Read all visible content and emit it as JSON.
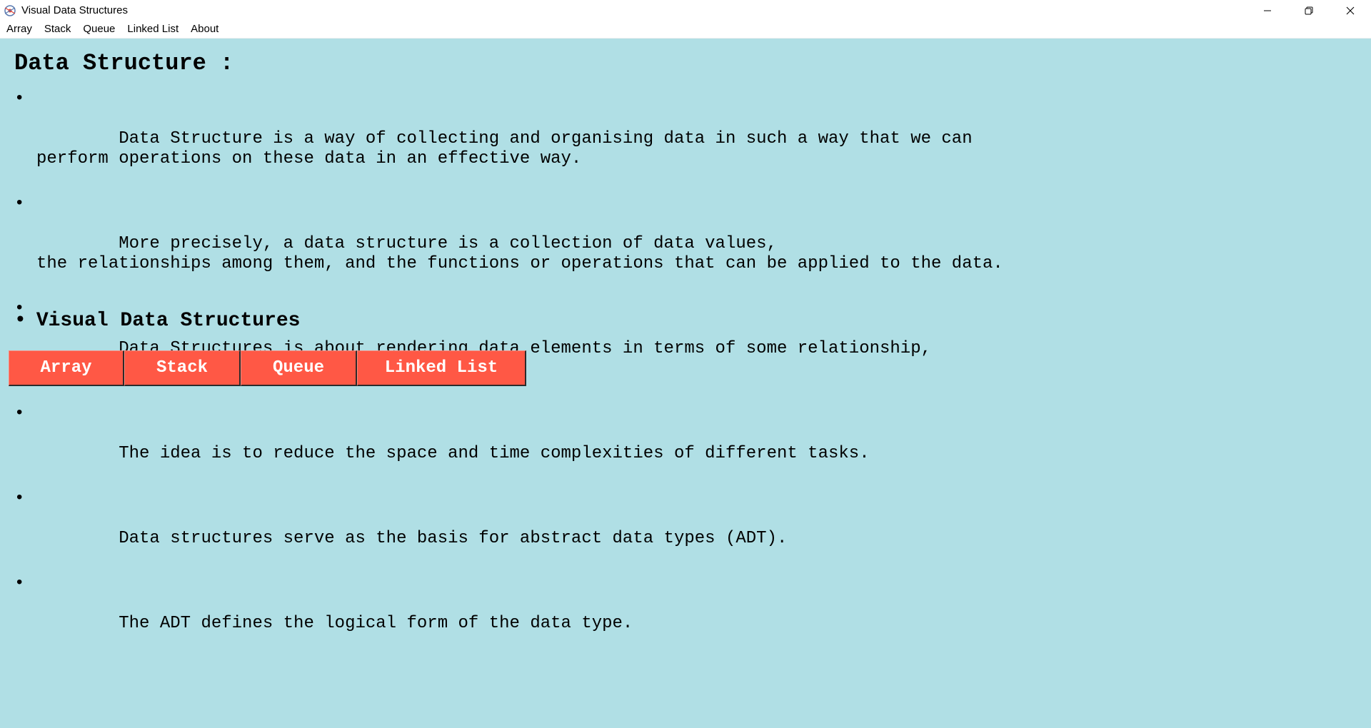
{
  "window": {
    "title": "Visual Data Structures"
  },
  "menu": {
    "items": [
      "Array",
      "Stack",
      "Queue",
      "Linked List",
      "About"
    ]
  },
  "main": {
    "heading": "Data Structure :",
    "bullets": [
      "Data Structure is a way of collecting and organising data in such a way that we can\nperform operations on these data in an effective way.",
      "More precisely, a data structure is a collection of data values,\nthe relationships among them, and the functions or operations that can be applied to the data.",
      "Data Structures is about rendering data elements in terms of some relationship,\nfor better organization and storage.",
      "The idea is to reduce the space and time complexities of different tasks.",
      "Data structures serve as the basis for abstract data types (ADT).",
      "The ADT defines the logical form of the data type."
    ],
    "bullet_symbol": "•",
    "subheading": "Visual Data Structures",
    "buttons": [
      "Array",
      "Stack",
      "Queue",
      "Linked List"
    ]
  },
  "colors": {
    "background": "#b0dfe5",
    "button": "#ff5845",
    "button_text": "#ffffff"
  }
}
